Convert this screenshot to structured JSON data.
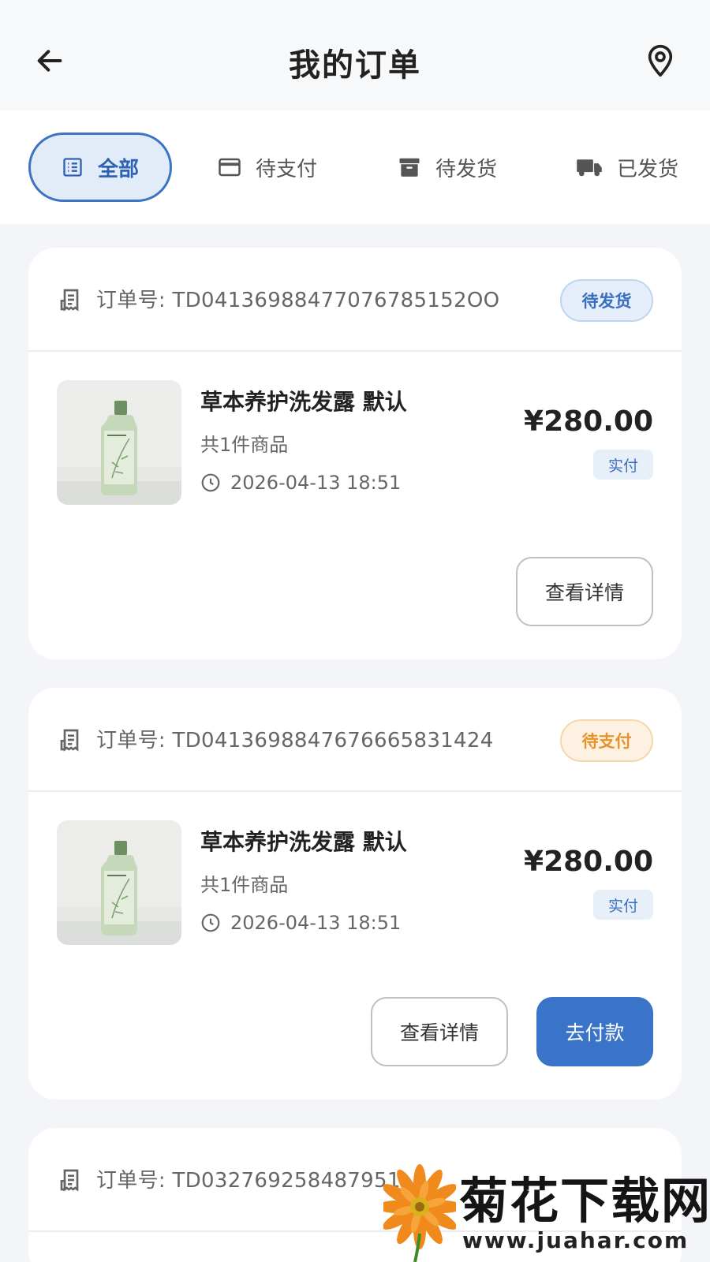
{
  "header": {
    "title": "我的订单"
  },
  "tabs": [
    {
      "label": "全部",
      "icon": "list-icon",
      "active": true
    },
    {
      "label": "待支付",
      "icon": "credit-card-icon",
      "active": false
    },
    {
      "label": "待发货",
      "icon": "archive-box-icon",
      "active": false
    },
    {
      "label": "已发货",
      "icon": "truck-icon",
      "active": false
    }
  ],
  "orders": [
    {
      "order_no": "订单号: TD04136988477076785152OO",
      "status": "待发货",
      "status_color": "#3a6fc0",
      "product_name": "草本养护洗发露 默认",
      "count": "共1件商品",
      "time": "2026-04-13 18:51",
      "price": "¥280.00",
      "paid_label": "实付",
      "actions": [
        "查看详情"
      ]
    },
    {
      "order_no": "订单号: TD0413698847676665831424",
      "status": "待支付",
      "status_color": "#e7932d",
      "product_name": "草本养护洗发露 默认",
      "count": "共1件商品",
      "time": "2026-04-13 18:51",
      "price": "¥280.00",
      "paid_label": "实付",
      "actions": [
        "查看详情",
        "去付款"
      ]
    },
    {
      "order_no": "订单号: TD032769258487951"
    }
  ],
  "watermark": {
    "text": "菊花下载网",
    "url": "www.juahar.com"
  },
  "colors": {
    "accent": "#3a74c9",
    "background": "#f4f5f8",
    "pending_ship": "#3a6fc0",
    "pending_pay": "#e7932d"
  }
}
